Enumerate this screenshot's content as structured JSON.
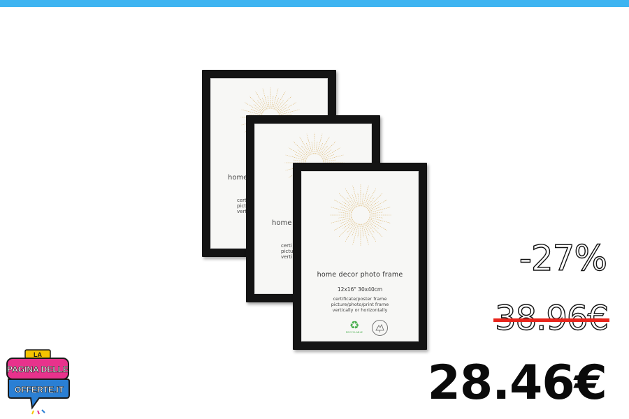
{
  "product": {
    "frames": {
      "front": {
        "title": "home decor photo frame",
        "size": "12x16\"  30x40cm",
        "lines": [
          "certificate/poster frame",
          "picture/photo/print frame",
          "vertically or horizontally"
        ],
        "recycle_label": "RECYCLABLE"
      },
      "peek_title_back": "home",
      "peek_title_mid": "home d",
      "peek_lines_back": [
        "certi",
        "pictu",
        "verti"
      ],
      "peek_lines_mid": [
        "certi",
        "pictu",
        "verti"
      ]
    }
  },
  "pricing": {
    "discount": "-27%",
    "old_price": "38.96€",
    "new_price": "28.46€"
  },
  "logo": {
    "line1": "LA",
    "line2": "PAGINA DELLE",
    "line3": "OFFERTE.IT"
  },
  "colors": {
    "top_bar": "#3eb4f1",
    "strike": "#e8251c",
    "logo_blue": "#2a7fd4",
    "logo_pink": "#e8328c",
    "logo_yellow": "#f5c400"
  }
}
